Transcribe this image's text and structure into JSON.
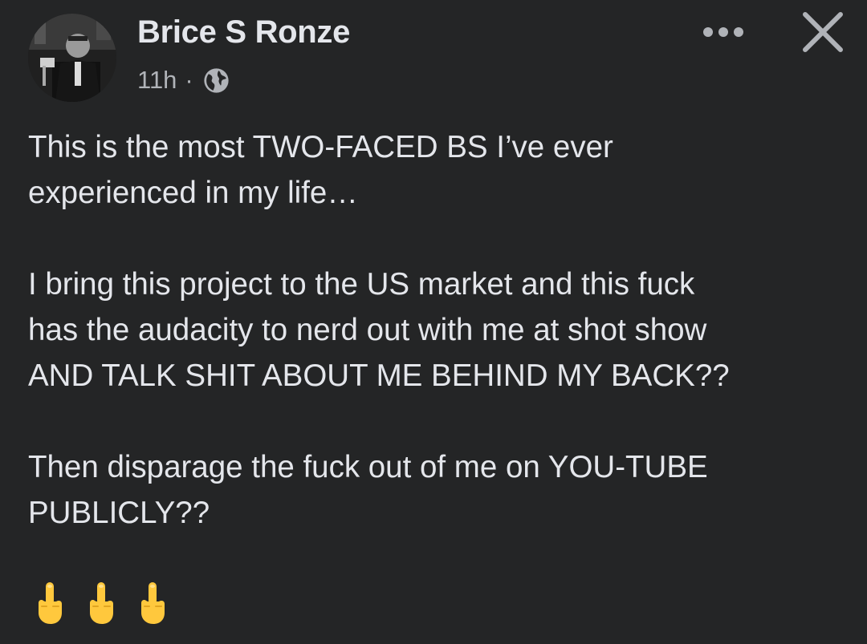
{
  "post": {
    "author": "Brice S Ronze",
    "time": "11h",
    "separator": "·",
    "privacy_icon": "globe-icon",
    "body": "This is the most TWO-FACED BS I’ve ever\nexperienced in my life…\n\nI bring this project to the US market and this fuck\nhas the audacity to nerd out with me at shot show\nAND TALK SHIT ABOUT ME BEHIND MY BACK??\n\nThen disparage the fuck out of me on YOU-TUBE\nPUBLICLY??",
    "emojis": [
      "middle-finger-emoji",
      "middle-finger-emoji",
      "middle-finger-emoji"
    ]
  },
  "actions": {
    "more_icon": "more-options-icon",
    "close_icon": "close-icon"
  },
  "colors": {
    "background": "#242526",
    "primary_text": "#e4e6eb",
    "secondary_text": "#b0b3b8",
    "emoji_yellow": "#ffc83d"
  }
}
